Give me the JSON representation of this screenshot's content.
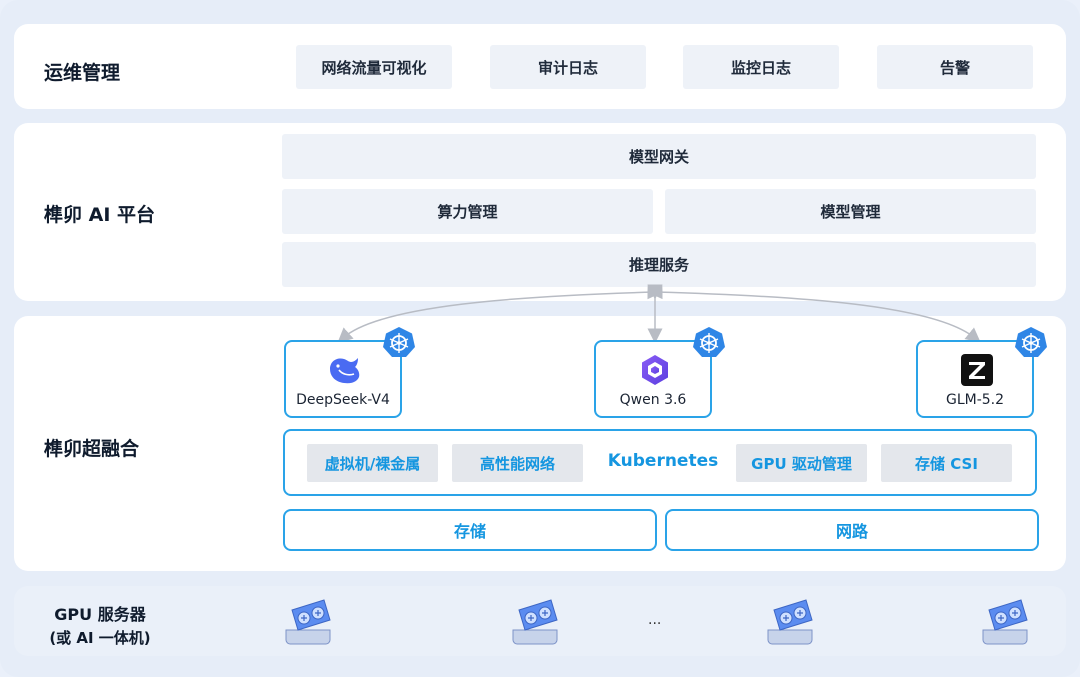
{
  "ops": {
    "title": "运维管理",
    "items": [
      "网络流量可视化",
      "审计日志",
      "监控日志",
      "告警"
    ]
  },
  "platform": {
    "title": "榫卯 AI 平台",
    "gateway": "模型网关",
    "compute": "算力管理",
    "model_mgmt": "模型管理",
    "inference": "推理服务"
  },
  "hci": {
    "title": "榫卯超融合",
    "models": [
      {
        "name": "DeepSeek-V4",
        "icon": "deepseek-whale-icon"
      },
      {
        "name": "Qwen 3.6",
        "icon": "qwen-logo-icon"
      },
      {
        "name": "GLM-5.2",
        "icon": "zhipu-z-icon"
      }
    ],
    "kubernetes": {
      "label": "Kubernetes",
      "items": [
        "虚拟机/裸金属",
        "高性能网络",
        "GPU 驱动管理",
        "存储 CSI"
      ]
    },
    "storage": "存储",
    "network": "网路"
  },
  "gpu": {
    "title_line1": "GPU 服务器",
    "title_line2": "(或 AI 一体机)",
    "ellipsis": "..."
  },
  "colors": {
    "accent": "#2aa3e8",
    "accent_text": "#1596e0",
    "box_fill": "#eef2f8",
    "background": "#e6edf8"
  }
}
